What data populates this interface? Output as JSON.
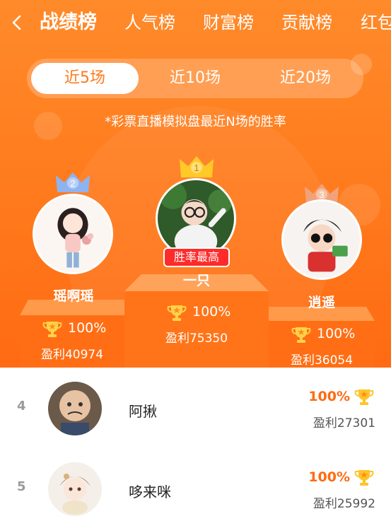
{
  "nav": {
    "tabs": [
      {
        "label": "战绩榜",
        "active": true
      },
      {
        "label": "人气榜"
      },
      {
        "label": "财富榜"
      },
      {
        "label": "贡献榜"
      },
      {
        "label": "红包"
      }
    ]
  },
  "segment": {
    "options": [
      {
        "label": "近5场",
        "active": true
      },
      {
        "label": "近10场"
      },
      {
        "label": "近20场"
      }
    ]
  },
  "subtitle": "*彩票直播模拟盘最近N场的胜率",
  "podium": {
    "first": {
      "rank": "1",
      "name": "一只",
      "badge": "胜率最高",
      "rate": "100%",
      "profit": "盈利75350"
    },
    "second": {
      "rank": "2",
      "name": "瑶啊瑶",
      "rate": "100%",
      "profit": "盈利40974"
    },
    "third": {
      "rank": "3",
      "name": "逍遥",
      "rate": "100%",
      "profit": "盈利36054"
    }
  },
  "list": [
    {
      "rank": "4",
      "name": "阿揪",
      "rate": "100%",
      "profit": "盈利27301"
    },
    {
      "rank": "5",
      "name": "哆来咪",
      "rate": "100%",
      "profit": "盈利25992"
    }
  ],
  "colors": {
    "accent": "#ff7a1c",
    "rate_text": "#ff6a10",
    "badge": "#ff2b2b"
  }
}
